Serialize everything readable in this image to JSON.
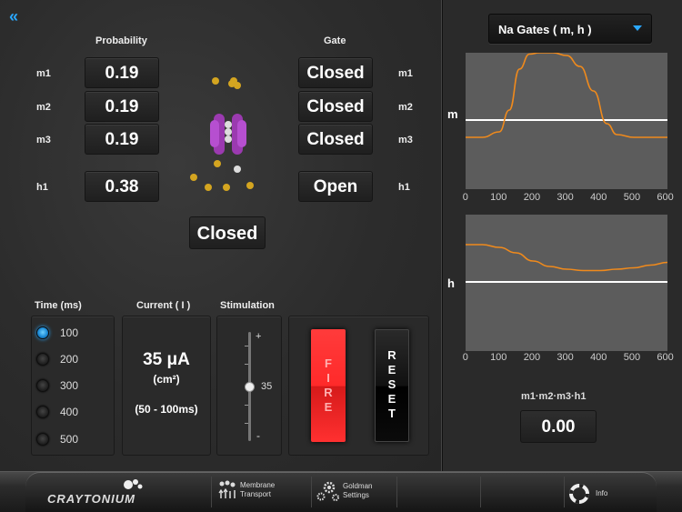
{
  "header": {
    "back_icon": "double-chevron-left-icon"
  },
  "gates_panel": {
    "probability_header": "Probability",
    "gate_header": "Gate",
    "rows": [
      {
        "label": "m1",
        "probability": "0.19",
        "gate": "Closed"
      },
      {
        "label": "m2",
        "probability": "0.19",
        "gate": "Closed"
      },
      {
        "label": "m3",
        "probability": "0.19",
        "gate": "Closed"
      },
      {
        "label": "h1",
        "probability": "0.38",
        "gate": "Open"
      }
    ],
    "channel_state": "Closed"
  },
  "time_panel": {
    "header": "Time (ms)",
    "options": [
      "100",
      "200",
      "300",
      "400",
      "500"
    ],
    "selected": "100"
  },
  "current_panel": {
    "header": "Current ( I )",
    "value": "35 μA",
    "unit": "(cm²)",
    "range": "(50 - 100ms)"
  },
  "stimulation_panel": {
    "header": "Stimulation",
    "plus": "+",
    "minus": "-",
    "value": "35"
  },
  "controls": {
    "fire_label": "FIRE",
    "reset_label": "RESET",
    "fire_color": "#ff2a2a"
  },
  "graph_panel": {
    "dropdown_label": "Na Gates ( m, h )",
    "m_label": "m",
    "h_label": "h",
    "x_ticks": [
      "0",
      "100",
      "200",
      "300",
      "400",
      "500",
      "600"
    ],
    "line_color": "#f08a1c",
    "product_label": "m1·m2·m3·h1",
    "product_value": "0.00"
  },
  "chart_data": [
    {
      "type": "line",
      "series": [
        {
          "x": [
            0,
            50,
            100,
            130,
            160,
            190,
            220,
            260,
            300,
            340,
            380,
            420,
            450,
            500,
            600
          ],
          "y": [
            0.38,
            0.38,
            0.42,
            0.58,
            0.88,
            0.99,
            1.0,
            1.0,
            0.98,
            0.9,
            0.72,
            0.48,
            0.4,
            0.38,
            0.38
          ]
        }
      ],
      "xlim": [
        0,
        600
      ],
      "ylim": [
        0,
        1
      ]
    },
    {
      "type": "line",
      "series": [
        {
          "x": [
            0,
            50,
            100,
            150,
            200,
            250,
            300,
            350,
            400,
            450,
            500,
            550,
            600
          ],
          "y": [
            0.78,
            0.78,
            0.76,
            0.72,
            0.66,
            0.62,
            0.6,
            0.59,
            0.59,
            0.6,
            0.61,
            0.63,
            0.65
          ]
        }
      ],
      "xlim": [
        0,
        600
      ],
      "ylim": [
        0,
        1
      ]
    }
  ],
  "bottom_bar": {
    "logo": "CRAYTONIUM",
    "items": [
      {
        "icon": "membrane-transport-icon",
        "line1": "Membrane",
        "line2": "Transport"
      },
      {
        "icon": "gears-icon",
        "line1": "Goldman",
        "line2": "Settings"
      },
      {
        "icon": "lifebuoy-icon",
        "line1": "Info",
        "line2": ""
      }
    ]
  }
}
